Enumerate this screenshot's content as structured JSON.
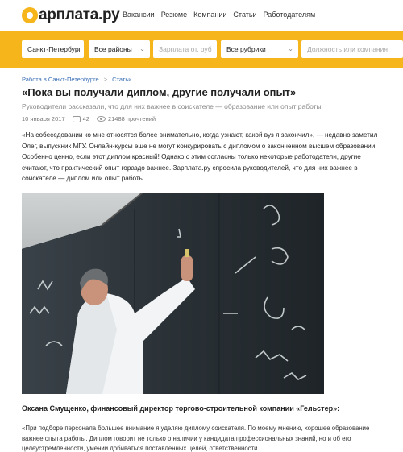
{
  "header": {
    "logo_text": "арплата.ру",
    "nav": [
      "Вакансии",
      "Резюме",
      "Компании",
      "Статьи",
      "Работодателям"
    ]
  },
  "search": {
    "city": "Санкт-Петербург",
    "city_clear": "×",
    "district": "Все районы",
    "salary_placeholder": "Зарплата от, руб",
    "rubric": "Все рубрики",
    "position_placeholder": "Должность или компания"
  },
  "breadcrumbs": [
    "Работа в Санкт-Петербурге",
    "Статьи"
  ],
  "breadcrumb_sep": ">",
  "article": {
    "title": "«Пока вы получали диплом, другие получали опыт»",
    "subtitle": "Руководители рассказали, что для них важнее в соискателе — образование или опыт работы",
    "date": "10 января 2017",
    "comments": "42",
    "views": "21488 прочтений",
    "lead": "«На собеседовании ко мне относятся более внимательно, когда узнают, какой вуз я закончил», — недавно заметил Олег, выпускник МГУ. Онлайн-курсы еще не могут конкурировать с дипломом о законченном высшем образовании. Особенно ценно, если этот диплом красный! Однако с этим согласны только некоторые работодатели, другие считают, что практический опыт гораздо важнее. Зарплата.ру спросила руководителей, что для них важнее в соискателе — диплом или опыт работы.",
    "person_heading": "Оксана Смущенко, финансовый директор торгово-строительной компании «Гельстер»:",
    "quote": "«При подборе персонала большее внимание я уделяю диплому соискателя. По моему мнению, хорошее образование важнее опыта работы. Диплом говорит не только о наличии у кандидата профессиональных знаний, но и об его целеустремленности, умении добиваться поставленных целей, ответственности."
  },
  "colors": {
    "brand_yellow": "#f5b51b",
    "link_blue": "#3b6fb6"
  }
}
